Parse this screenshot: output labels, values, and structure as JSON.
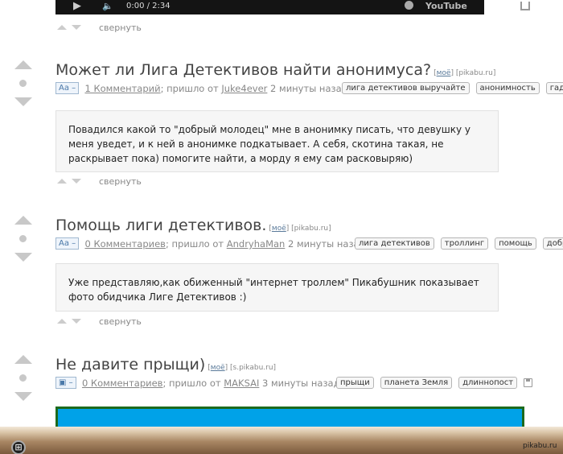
{
  "video": {
    "time": "0:00 / 2:34",
    "brand": "YouTube",
    "play_icon": "play-icon",
    "volume_icon": "volume-icon"
  },
  "collapse_label": "свернуть",
  "posts": [
    {
      "title": "Может ли Лига Детективов найти анонимуса?",
      "mine_label": "моё",
      "source": "pikabu.ru",
      "format_label": "Аа –",
      "comments": "1 Комментарий",
      "came_from_label": "; пришло от ",
      "author": "Juke4ever",
      "time_ago": " 2 минуты назад",
      "tags": [
        "лига детективов выручайте",
        "анонимность",
        "гады"
      ],
      "body": "Повадился какой то \"добрый молодец\" мне в анонимку писать, что девушку у меня уведет, и к ней в анонимке подкатывает. А себя, скотина такая, не раскрывает пока) помогите найти, а морду я ему сам расковыряю)"
    },
    {
      "title": "Помощь лиги детективов.",
      "mine_label": "моё",
      "source": "pikabu.ru",
      "format_label": "Аа –",
      "comments": "0 Комментариев",
      "came_from_label": "; пришло от ",
      "author": "AndryhaMan",
      "time_ago": " 2 минуты назад",
      "tags": [
        "лига детективов",
        "троллинг",
        "помощь",
        "добро"
      ],
      "body": "Уже представляю,как обиженный \"интернет троллем\" Пикабушник показывает фото обидчика Лиге Детективов :)"
    },
    {
      "title": "Не давите прыщи)",
      "mine_label": "моё",
      "source": "s.pikabu.ru",
      "format_label": "–",
      "comments": "0 Комментариев",
      "came_from_label": "; пришло от ",
      "author": "MAKSAI",
      "time_ago": " 3 минуты назад",
      "tags": [
        "прыщи",
        "планета Земля",
        "длиннопост"
      ]
    }
  ],
  "watermark": "pikabu.ru",
  "colors": {
    "image_fill": "#00a2e8",
    "image_border": "#1d6a1d",
    "format_badge": "#4a78a8"
  }
}
